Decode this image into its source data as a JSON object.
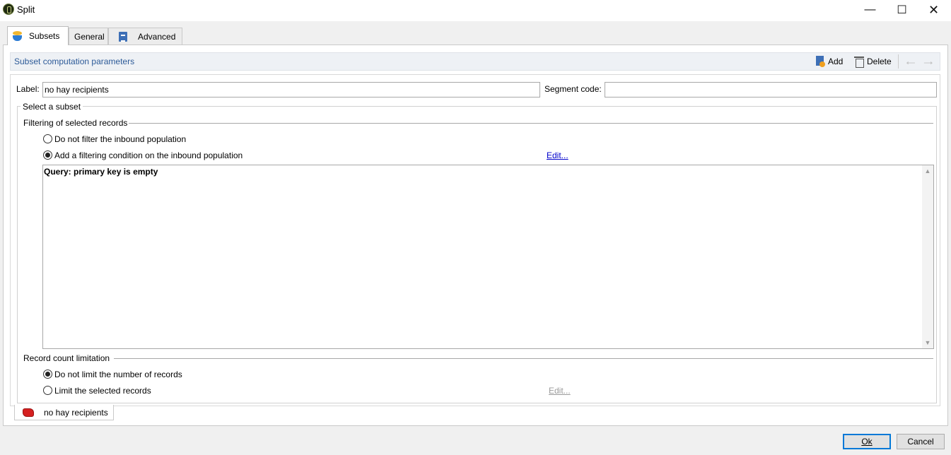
{
  "window": {
    "title": "Split"
  },
  "tabs": [
    {
      "label": "Subsets",
      "icon": "subsets-icon",
      "active": true
    },
    {
      "label": "General",
      "active": false
    },
    {
      "label": "Advanced",
      "icon": "advanced-icon",
      "active": false
    }
  ],
  "panel": {
    "header_title": "Subset computation parameters",
    "toolbar": {
      "add_label": "Add",
      "delete_label": "Delete"
    }
  },
  "form": {
    "label_caption": "Label:",
    "label_value": "no hay recipients",
    "segment_caption": "Segment code:",
    "segment_value": ""
  },
  "select_subset": {
    "legend": "Select a subset",
    "filtering": {
      "title": "Filtering of selected records",
      "option_no_filter": "Do not filter the inbound population",
      "option_add_filter": "Add a filtering condition on the inbound population",
      "selected": "add_filter",
      "edit_link": "Edit...",
      "query_text": "Query: primary key is empty"
    },
    "limitation": {
      "title": "Record count limitation",
      "option_no_limit": "Do not limit the number of records",
      "option_limit": "Limit the selected records",
      "selected": "no_limit",
      "edit_link": "Edit..."
    }
  },
  "subset_tab": {
    "label": "no hay recipients",
    "icon": "subset-red-icon"
  },
  "buttons": {
    "ok": "Ok",
    "cancel": "Cancel"
  },
  "colors": {
    "accent": "#0078d7",
    "header_text": "#2c5a98",
    "link": "#0000cc"
  }
}
